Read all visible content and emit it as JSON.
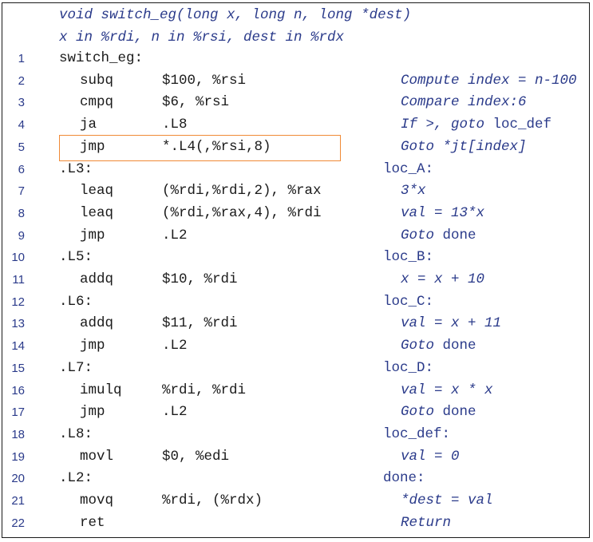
{
  "header": [
    "void switch_eg(long x, long n, long *dest)",
    "x in %rdi, n in %rsi, dest in %rdx"
  ],
  "lines": [
    {
      "num": "1",
      "ind": 0,
      "op": "switch_eg:",
      "args": "",
      "cm": "",
      "cmk": "none"
    },
    {
      "num": "2",
      "ind": 1,
      "op": "subq",
      "args": "$100, %rsi",
      "cm": "Compute index = n-100",
      "cmk": "ital"
    },
    {
      "num": "3",
      "ind": 1,
      "op": "cmpq",
      "args": "$6, %rsi",
      "cm": "Compare index:6",
      "cmk": "ital"
    },
    {
      "num": "4",
      "ind": 1,
      "op": "ja",
      "args": ".L8",
      "cm": "If >, goto loc_def",
      "cmk": "mixed"
    },
    {
      "num": "5",
      "ind": 1,
      "op": "jmp",
      "args": "*.L4(,%rsi,8)",
      "cm": "Goto *jt[index]",
      "cmk": "ital"
    },
    {
      "num": "6",
      "ind": 0,
      "op": ".L3:",
      "args": "",
      "cm": "loc_A:",
      "cmk": "label"
    },
    {
      "num": "7",
      "ind": 1,
      "op": "leaq",
      "args": "(%rdi,%rdi,2), %rax",
      "cm": "3*x",
      "cmk": "ital"
    },
    {
      "num": "8",
      "ind": 1,
      "op": "leaq",
      "args": "(%rdi,%rax,4), %rdi",
      "cm": "val = 13*x",
      "cmk": "ital"
    },
    {
      "num": "9",
      "ind": 1,
      "op": "jmp",
      "args": ".L2",
      "cm": "Goto done",
      "cmk": "goto"
    },
    {
      "num": "10",
      "ind": 0,
      "op": ".L5:",
      "args": "",
      "cm": "loc_B:",
      "cmk": "label"
    },
    {
      "num": "11",
      "ind": 1,
      "op": "addq",
      "args": "$10, %rdi",
      "cm": "x = x + 10",
      "cmk": "ital"
    },
    {
      "num": "12",
      "ind": 0,
      "op": ".L6:",
      "args": "",
      "cm": "loc_C:",
      "cmk": "label"
    },
    {
      "num": "13",
      "ind": 1,
      "op": "addq",
      "args": "$11, %rdi",
      "cm": "val = x + 11",
      "cmk": "ital"
    },
    {
      "num": "14",
      "ind": 1,
      "op": "jmp",
      "args": ".L2",
      "cm": "Goto done",
      "cmk": "goto"
    },
    {
      "num": "15",
      "ind": 0,
      "op": ".L7:",
      "args": "",
      "cm": "loc_D:",
      "cmk": "label"
    },
    {
      "num": "16",
      "ind": 1,
      "op": "imulq",
      "args": "%rdi, %rdi",
      "cm": "val = x * x",
      "cmk": "ital"
    },
    {
      "num": "17",
      "ind": 1,
      "op": "jmp",
      "args": ".L2",
      "cm": "Goto done",
      "cmk": "goto"
    },
    {
      "num": "18",
      "ind": 0,
      "op": ".L8:",
      "args": "",
      "cm": "loc_def:",
      "cmk": "label"
    },
    {
      "num": "19",
      "ind": 1,
      "op": "movl",
      "args": "$0, %edi",
      "cm": "val = 0",
      "cmk": "ital"
    },
    {
      "num": "20",
      "ind": 0,
      "op": ".L2:",
      "args": "",
      "cm": "done:",
      "cmk": "label"
    },
    {
      "num": "21",
      "ind": 1,
      "op": "movq",
      "args": "%rdi, (%rdx)",
      "cm": "*dest = val",
      "cmk": "ital"
    },
    {
      "num": "22",
      "ind": 1,
      "op": "ret",
      "args": "",
      "cm": "Return",
      "cmk": "ital"
    }
  ],
  "highlight_line": "5",
  "colors": {
    "code": "#1a1a1a",
    "comment": "#2a3a8a",
    "highlight": "#f08a36",
    "border": "#1a1a1a"
  }
}
